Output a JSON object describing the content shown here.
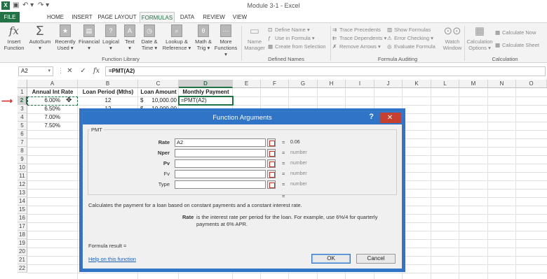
{
  "app": {
    "title": "Module 3-1 - Excel",
    "logo": "X"
  },
  "quick_access": {
    "save_icon": "save-icon",
    "undo_icon": "undo-icon",
    "redo_icon": "redo-icon"
  },
  "tabs": [
    {
      "label": "FILE"
    },
    {
      "label": "HOME"
    },
    {
      "label": "INSERT"
    },
    {
      "label": "PAGE LAYOUT"
    },
    {
      "label": "FORMULAS"
    },
    {
      "label": "DATA"
    },
    {
      "label": "REVIEW"
    },
    {
      "label": "VIEW"
    }
  ],
  "ribbon": {
    "function_library": {
      "label": "Function Library",
      "buttons": [
        {
          "label1": "Insert",
          "label2": "Function",
          "icon": "fx-icon"
        },
        {
          "label1": "AutoSum",
          "label2": "▾",
          "icon": "sigma-icon"
        },
        {
          "label1": "Recently",
          "label2": "Used ▾",
          "icon": "star-icon"
        },
        {
          "label1": "Financial",
          "label2": "▾",
          "icon": "book-icon"
        },
        {
          "label1": "Logical",
          "label2": "▾",
          "icon": "question-book-icon"
        },
        {
          "label1": "Text",
          "label2": "▾",
          "icon": "text-book-icon"
        },
        {
          "label1": "Date &",
          "label2": "Time ▾",
          "icon": "clock-book-icon"
        },
        {
          "label1": "Lookup &",
          "label2": "Reference ▾",
          "icon": "lookup-book-icon"
        },
        {
          "label1": "Math &",
          "label2": "Trig ▾",
          "icon": "theta-book-icon"
        },
        {
          "label1": "More",
          "label2": "Functions ▾",
          "icon": "more-book-icon"
        }
      ]
    },
    "defined_names": {
      "label": "Defined Names",
      "name_manager": {
        "label1": "Name",
        "label2": "Manager"
      },
      "items": [
        "Define Name ▾",
        "Use in Formula ▾",
        "Create from Selection"
      ]
    },
    "formula_auditing": {
      "label": "Formula Auditing",
      "col1": [
        "Trace Precedents",
        "Trace Dependents ▾",
        "Remove Arrows ▾"
      ],
      "col2": [
        "Show Formulas",
        "Error Checking ▾",
        "Evaluate Formula"
      ],
      "watch": {
        "label1": "Watch",
        "label2": "Window"
      }
    },
    "calculation": {
      "label": "Calculation",
      "options": {
        "label1": "Calculation",
        "label2": "Options ▾"
      },
      "items": [
        "Calculate Now",
        "Calculate Sheet"
      ]
    }
  },
  "formula_bar": {
    "name_box": "A2",
    "cancel": "✕",
    "enter": "✓",
    "fx": "fx",
    "formula": "=PMT(A2)"
  },
  "columns": [
    "A",
    "B",
    "C",
    "D",
    "E",
    "F",
    "G",
    "H",
    "I",
    "J",
    "K",
    "L",
    "M",
    "N",
    "O"
  ],
  "rows": [
    "1",
    "2",
    "3",
    "4",
    "5",
    "6",
    "7",
    "8",
    "9",
    "10",
    "11",
    "12",
    "13",
    "14",
    "15",
    "16",
    "17",
    "18",
    "19",
    "20",
    "21",
    "22"
  ],
  "cells": {
    "A1": "Annual Int Rate",
    "B1": "Loan Period (Mths)",
    "C1": "Loan Amount",
    "D1": "Monthly Payment",
    "A2": "6.00%",
    "B2": "12",
    "C2_sym": "$",
    "C2": "10,000.00",
    "D2": "=PMT(A2)",
    "A3": "6.50%",
    "B3": "12",
    "C3_sym": "$",
    "C3": "10,000.00",
    "A4": "7.00%",
    "A5": "7.50%"
  },
  "dialog": {
    "title": "Function Arguments",
    "help_glyph": "?",
    "close_glyph": "✕",
    "function_name": "PMT",
    "args": [
      {
        "label": "Rate",
        "value": "A2",
        "eq": "=",
        "result": "0.06"
      },
      {
        "label": "Nper",
        "value": "",
        "eq": "=",
        "result": "number"
      },
      {
        "label": "Pv",
        "value": "",
        "eq": "=",
        "result": "number"
      },
      {
        "label": "Fv",
        "value": "",
        "eq": "=",
        "result": "number"
      },
      {
        "label": "Type",
        "value": "",
        "eq": "=",
        "result": "number"
      }
    ],
    "total_eq": "=",
    "description": "Calculates the payment for a loan based on constant payments and a constant interest rate.",
    "arg_help_name": "Rate",
    "arg_help_text": "is the interest rate per period for the loan. For example, use 6%/4 for quarterly payments at 6% APR.",
    "formula_result": "Formula result =",
    "help_link": "Help on this function",
    "ok": "OK",
    "cancel": "Cancel"
  },
  "colors": {
    "excel_green": "#217346",
    "dialog_blue": "#2f74c6",
    "close_red": "#c7402f",
    "arrow_red": "#dd2222"
  }
}
